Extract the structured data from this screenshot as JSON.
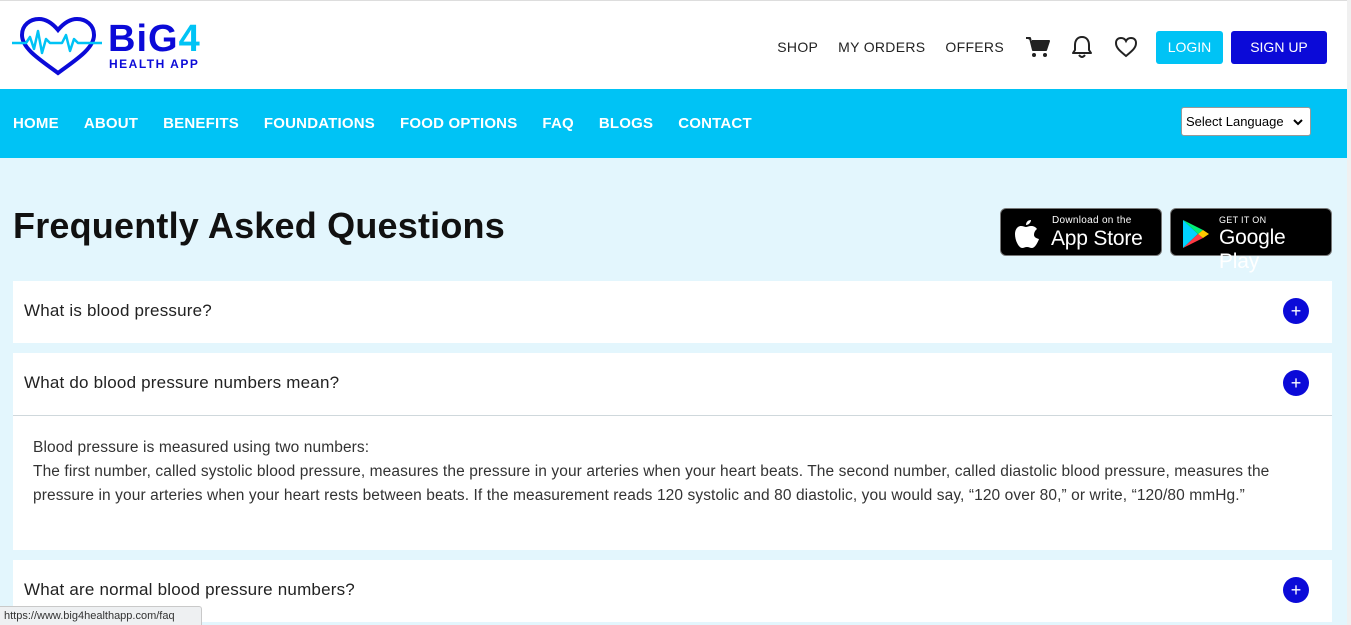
{
  "brand": {
    "name_main": "BiG",
    "name_accent": "4",
    "tagline": "HEALTH APP"
  },
  "header": {
    "links": [
      "SHOP",
      "MY ORDERS",
      "OFFERS"
    ],
    "icons": [
      "cart-icon",
      "bell-icon",
      "heart-icon"
    ],
    "login_label": "LOGIN",
    "signup_label": "SIGN UP"
  },
  "nav": {
    "items": [
      "HOME",
      "ABOUT",
      "BENEFITS",
      "FOUNDATIONS",
      "FOOD OPTIONS",
      "FAQ",
      "BLOGS",
      "CONTACT"
    ],
    "language_select": "Select Language"
  },
  "page": {
    "title": "Frequently Asked Questions"
  },
  "stores": {
    "apple": {
      "small": "Download on the",
      "big": "App Store"
    },
    "google": {
      "small": "GET IT ON",
      "big": "Google Play"
    }
  },
  "faq": [
    {
      "question": "What is blood pressure?",
      "expanded": false
    },
    {
      "question": "What do blood pressure numbers mean?",
      "expanded": true,
      "answer_line1": "Blood pressure is measured using two numbers:",
      "answer_line2": "The first number, called systolic blood pressure, measures the pressure in your arteries when your heart beats. The second number, called diastolic blood pressure, measures the pressure in your arteries when your heart rests between beats. If the measurement reads 120 systolic and 80 diastolic, you would say, “120 over 80,” or write, “120/80 mmHg.”"
    },
    {
      "question": "What are normal blood pressure numbers?",
      "expanded": false
    }
  ],
  "toggle_symbol": "+",
  "status_url": "https://www.big4healthapp.com/faq",
  "colors": {
    "primary": "#0b0ad8",
    "accent": "#00c3f5",
    "background": "#e3f6fd"
  }
}
